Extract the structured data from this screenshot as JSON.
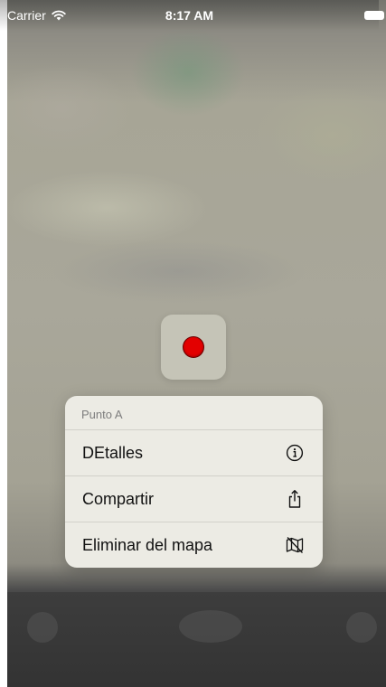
{
  "status_bar": {
    "carrier": "Carrier",
    "time": "8:17 AM",
    "icons": [
      "wifi-icon",
      "battery-icon"
    ]
  },
  "map": {
    "pin_color": "#e30000"
  },
  "context_menu": {
    "title": "Punto A",
    "items": [
      {
        "label": "DEtalles",
        "icon": "info-icon"
      },
      {
        "label": "Compartir",
        "icon": "share-icon"
      },
      {
        "label": "Eliminar del mapa",
        "icon": "map-remove-icon"
      }
    ]
  }
}
